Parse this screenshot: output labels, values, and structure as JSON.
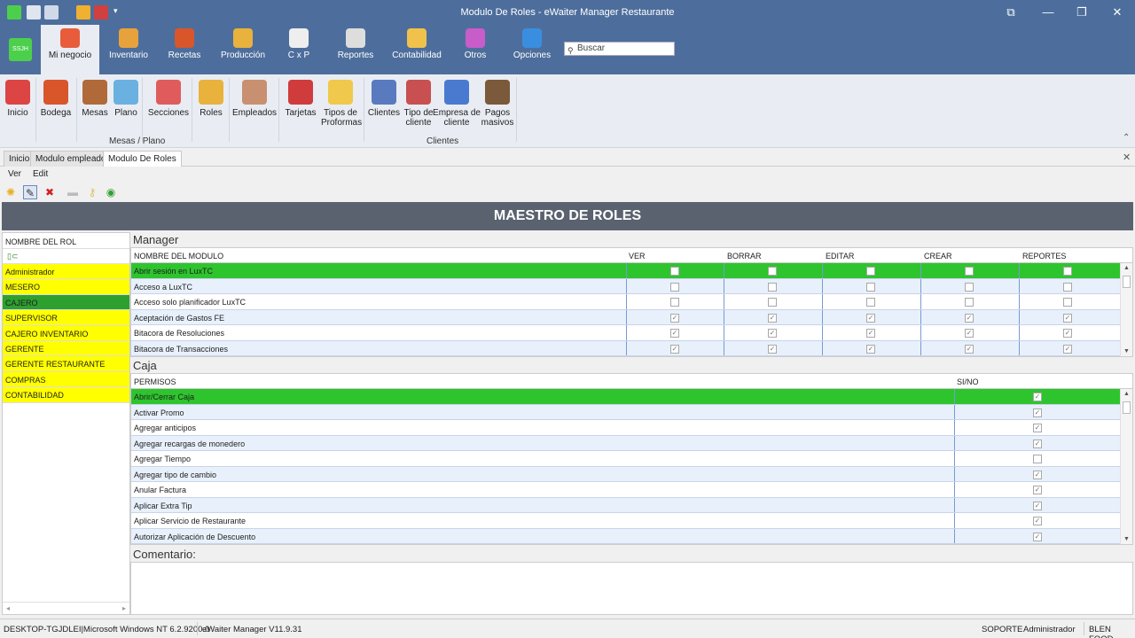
{
  "window": {
    "title": "Modulo De Roles - eWaiter Manager Restaurante"
  },
  "app_logo_text": "SSJH",
  "ribbon_tabs": [
    {
      "label": "Mi negocio",
      "icon": "store-icon",
      "color": "#e85c3c",
      "active": true
    },
    {
      "label": "Inventario",
      "icon": "boxes-icon",
      "color": "#e8a23c"
    },
    {
      "label": "Recetas",
      "icon": "recipe-book-icon",
      "color": "#d9562b"
    },
    {
      "label": "Producción",
      "icon": "production-icon",
      "color": "#e8b23c"
    },
    {
      "label": "C x P",
      "icon": "payables-icon",
      "color": "#eeeeee"
    },
    {
      "label": "Reportes",
      "icon": "report-icon",
      "color": "#dddddd"
    },
    {
      "label": "Contabilidad",
      "icon": "accounting-icon",
      "color": "#f0c24c"
    },
    {
      "label": "Otros",
      "icon": "others-icon",
      "color": "#c85cc8"
    },
    {
      "label": "Opciones",
      "icon": "gear-icon",
      "color": "#3a8ee0"
    }
  ],
  "search": {
    "placeholder": "Buscar"
  },
  "ribbon_buttons": [
    {
      "label": "Inicio",
      "icon": "home-chart-icon",
      "color": "#d44"
    },
    {
      "label": "Bodega",
      "icon": "warehouse-icon",
      "color": "#d9562b"
    },
    {
      "label": "Mesas",
      "icon": "tables-icon",
      "color": "#b06a3a"
    },
    {
      "label": "Plano",
      "icon": "blueprint-icon",
      "color": "#6ab0e0"
    },
    {
      "label": "Secciones",
      "icon": "sections-icon",
      "color": "#e05c5c"
    },
    {
      "label": "Roles",
      "icon": "keys-icon",
      "color": "#e8b23c"
    },
    {
      "label": "Empleados",
      "icon": "employee-icon",
      "color": "#c89070"
    },
    {
      "label": "Tarjetas",
      "icon": "cards-icon",
      "color": "#d03c3c"
    },
    {
      "label": "Tipos de\nProformas",
      "icon": "proforma-icon",
      "color": "#f0c84c"
    },
    {
      "label": "Clientes",
      "icon": "clients-icon",
      "color": "#5a7ac0"
    },
    {
      "label": "Tipo de\ncliente",
      "icon": "client-type-icon",
      "color": "#c85050"
    },
    {
      "label": "Empresa de\ncliente",
      "icon": "company-icon",
      "color": "#4a7ad0"
    },
    {
      "label": "Pagos\nmasivos",
      "icon": "mass-payments-icon",
      "color": "#7a5a3a"
    }
  ],
  "ribbon_groups": [
    "Mesas / Plano",
    "Clientes"
  ],
  "doc_tabs": [
    {
      "label": "Inicio"
    },
    {
      "label": "Modulo empleados"
    },
    {
      "label": "Modulo De Roles",
      "active": true
    }
  ],
  "menu": [
    "Ver",
    "Edit"
  ],
  "toolbar_icons": [
    "new-icon",
    "edit-icon",
    "delete-icon",
    "lock-icon",
    "key-icon",
    "refresh-icon"
  ],
  "banner": "MAESTRO DE ROLES",
  "roles": {
    "header": "NOMBRE DEL ROL",
    "items": [
      {
        "name": "Administrador"
      },
      {
        "name": "MESERO"
      },
      {
        "name": "CAJERO",
        "selected": true
      },
      {
        "name": "SUPERVISOR"
      },
      {
        "name": "CAJERO INVENTARIO"
      },
      {
        "name": "GERENTE"
      },
      {
        "name": "GERENTE RESTAURANTE"
      },
      {
        "name": "COMPRAS"
      },
      {
        "name": "CONTABILIDAD"
      }
    ]
  },
  "manager": {
    "title": "Manager",
    "columns": [
      "NOMBRE DEL MODULO",
      "VER",
      "BORRAR",
      "EDITAR",
      "CREAR",
      "REPORTES"
    ],
    "rows": [
      {
        "name": "Abrir sesión en LuxTC",
        "checks": [
          false,
          false,
          false,
          false,
          false
        ],
        "selected": true
      },
      {
        "name": "Acceso a LuxTC",
        "checks": [
          false,
          false,
          false,
          false,
          false
        ]
      },
      {
        "name": "Acceso solo planificador LuxTC",
        "checks": [
          false,
          false,
          false,
          false,
          false
        ]
      },
      {
        "name": "Aceptación de Gastos FE",
        "checks": [
          true,
          true,
          true,
          true,
          true
        ]
      },
      {
        "name": "Bitacora de Resoluciones",
        "checks": [
          true,
          true,
          true,
          true,
          true
        ]
      },
      {
        "name": "Bitacora de Transacciones",
        "checks": [
          true,
          true,
          true,
          true,
          true
        ]
      }
    ]
  },
  "caja": {
    "title": "Caja",
    "columns": [
      "PERMISOS",
      "SI/NO"
    ],
    "rows": [
      {
        "name": "Abrir/Cerrar Caja",
        "check": true,
        "selected": true
      },
      {
        "name": "Activar Promo",
        "check": true
      },
      {
        "name": "Agregar anticipos",
        "check": true
      },
      {
        "name": "Agregar recargas de monedero",
        "check": true
      },
      {
        "name": "Agregar Tiempo",
        "check": false
      },
      {
        "name": "Agregar tipo de cambio",
        "check": true
      },
      {
        "name": "Anular Factura",
        "check": true
      },
      {
        "name": "Aplicar Extra Tip",
        "check": true
      },
      {
        "name": "Aplicar Servicio de Restaurante",
        "check": true
      },
      {
        "name": "Autorizar Aplicación de Descuento",
        "check": true
      }
    ]
  },
  "comment": {
    "label": "Comentario:"
  },
  "status": {
    "machine": "DESKTOP-TGJDLEI|Microsoft Windows NT 6.2.9200.0",
    "version": "eWaiter Manager V11.9.31",
    "support": "SOPORTE",
    "user": "Administrador",
    "company": "BLEN FOOD"
  }
}
